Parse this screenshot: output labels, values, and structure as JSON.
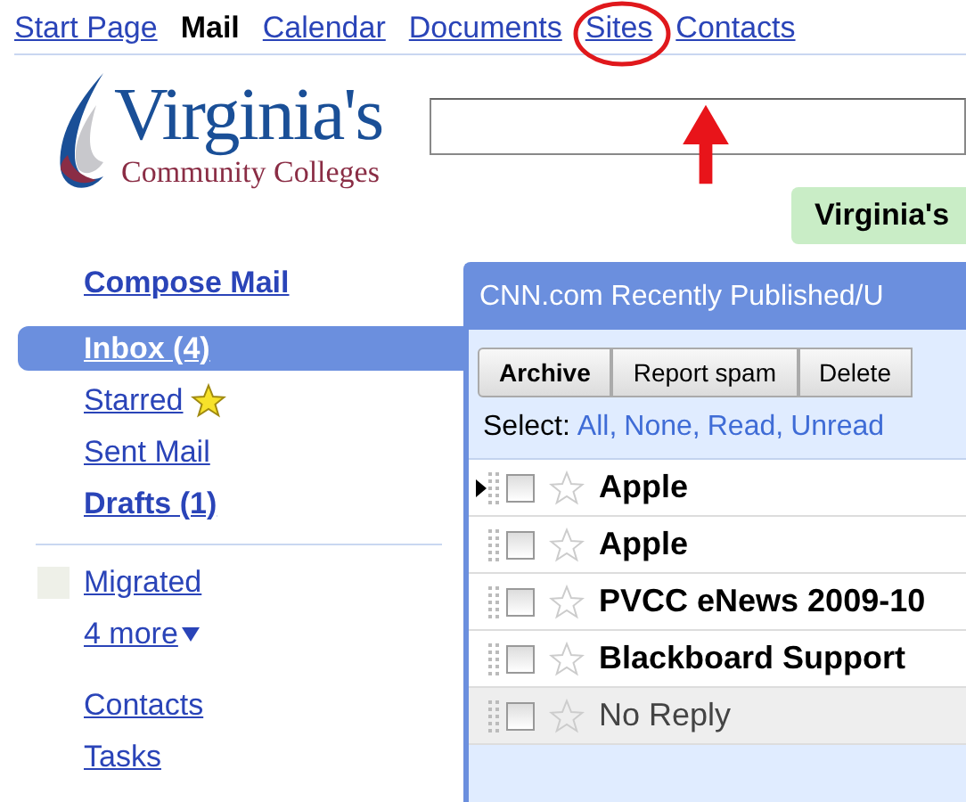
{
  "nav": [
    {
      "label": "Start Page",
      "selected": false,
      "annotated": false
    },
    {
      "label": "Mail",
      "selected": true,
      "annotated": false
    },
    {
      "label": "Calendar",
      "selected": false,
      "annotated": false
    },
    {
      "label": "Documents",
      "selected": false,
      "annotated": false
    },
    {
      "label": "Sites",
      "selected": false,
      "annotated": true
    },
    {
      "label": "Contacts",
      "selected": false,
      "annotated": false
    }
  ],
  "logo": {
    "title": "Virginia's",
    "subtitle": "Community Colleges"
  },
  "badge": "Virginia's",
  "sidebar": {
    "compose": "Compose Mail",
    "folders": [
      {
        "label": "Inbox (4)",
        "selected": true,
        "bold": true,
        "starred": false
      },
      {
        "label": "Starred",
        "selected": false,
        "bold": false,
        "starred": true
      },
      {
        "label": "Sent Mail",
        "selected": false,
        "bold": false,
        "starred": false
      },
      {
        "label": "Drafts (1)",
        "selected": false,
        "bold": true,
        "starred": false
      }
    ],
    "labels": [
      {
        "label": "Migrated",
        "kind": "label"
      },
      {
        "label": "4 more",
        "kind": "more"
      }
    ],
    "links": [
      "Contacts",
      "Tasks"
    ]
  },
  "panel": {
    "title": "CNN.com Recently Published/U",
    "buttons": [
      "Archive",
      "Report spam",
      "Delete"
    ],
    "select": {
      "label": "Select:",
      "options": [
        "All,",
        "None,",
        "Read,",
        "Unread"
      ]
    },
    "rows": [
      {
        "sender": "Apple",
        "unread": true,
        "current": true,
        "checked": false,
        "starred": false
      },
      {
        "sender": "Apple",
        "unread": true,
        "current": false,
        "checked": false,
        "starred": false
      },
      {
        "sender": "PVCC eNews 2009-10",
        "unread": true,
        "current": false,
        "checked": false,
        "starred": false
      },
      {
        "sender": "Blackboard Support",
        "unread": true,
        "current": false,
        "checked": false,
        "starred": false
      },
      {
        "sender": "No Reply",
        "unread": false,
        "current": false,
        "checked": false,
        "starred": false
      }
    ]
  }
}
